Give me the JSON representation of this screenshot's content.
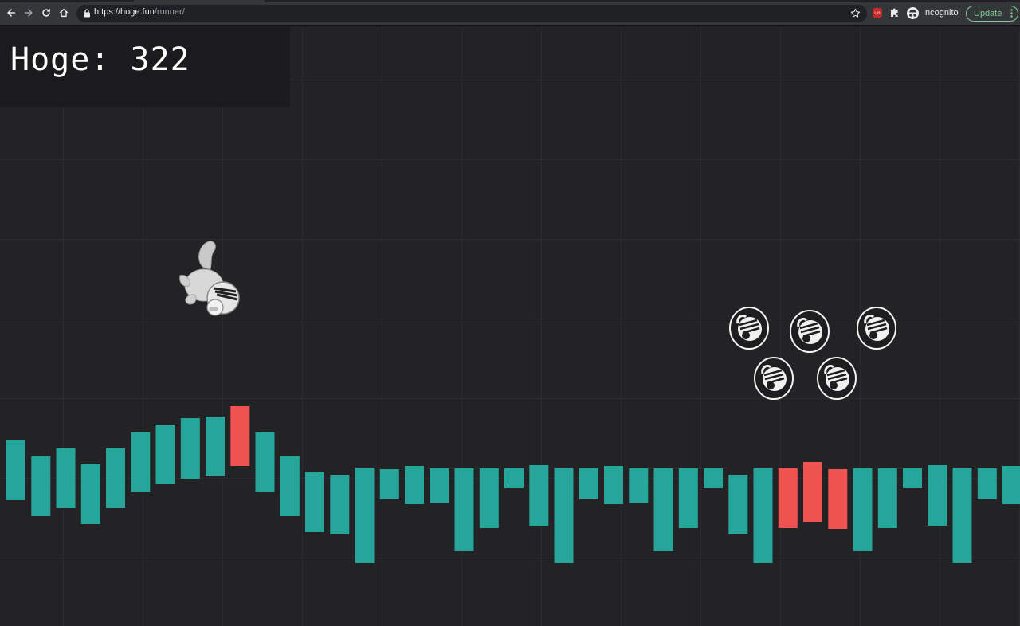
{
  "browser": {
    "url_host": "https://hoge.fun",
    "url_path": "/runner/",
    "profile_label": "Incognito",
    "update_label": "Update",
    "extension_badge": "uo"
  },
  "hud": {
    "score_text": "Hoge: 322"
  },
  "colors": {
    "up_candle": "#26a69a",
    "down_candle": "#ef5350",
    "update_green": "#81c995"
  },
  "icons": {
    "back": "back-arrow-icon",
    "forward": "forward-arrow-icon",
    "reload": "reload-icon",
    "home": "home-icon",
    "lock": "lock-icon",
    "bookmark": "star-icon",
    "extensions": "puzzle-icon",
    "player": "squirrel-icon",
    "coin": "hoge-coin-icon"
  },
  "game": {
    "candles": [
      {
        "color": "up"
      },
      {
        "color": "up"
      },
      {
        "color": "up"
      },
      {
        "color": "up"
      },
      {
        "color": "up"
      },
      {
        "color": "up"
      },
      {
        "color": "up"
      },
      {
        "color": "up"
      },
      {
        "color": "up"
      },
      {
        "color": "down"
      },
      {
        "color": "up"
      },
      {
        "color": "up"
      },
      {
        "color": "up"
      },
      {
        "color": "up"
      },
      {
        "color": "up"
      },
      {
        "color": "up"
      },
      {
        "color": "up"
      },
      {
        "color": "up"
      },
      {
        "color": "up"
      },
      {
        "color": "up"
      },
      {
        "color": "up"
      },
      {
        "color": "up"
      },
      {
        "color": "up"
      },
      {
        "color": "up"
      },
      {
        "color": "up"
      },
      {
        "color": "up"
      },
      {
        "color": "up"
      },
      {
        "color": "up"
      },
      {
        "color": "up"
      },
      {
        "color": "up"
      },
      {
        "color": "up"
      },
      {
        "color": "down"
      },
      {
        "color": "down"
      },
      {
        "color": "down"
      },
      {
        "color": "up"
      },
      {
        "color": "up"
      },
      {
        "color": "up"
      },
      {
        "color": "up"
      },
      {
        "color": "up"
      },
      {
        "color": "up"
      },
      {
        "color": "up"
      }
    ],
    "coin_count": 5
  }
}
